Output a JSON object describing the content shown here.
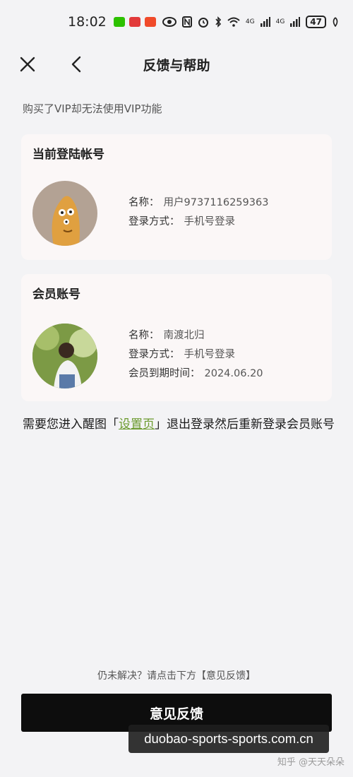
{
  "status_bar": {
    "time": "18:02",
    "network_4g_1": "4G",
    "network_4g_2": "4G",
    "battery": "47"
  },
  "nav": {
    "title": "反馈与帮助"
  },
  "section_title": "购买了VIP却无法使用VIP功能",
  "current_account": {
    "title": "当前登陆帐号",
    "name_label": "名称：",
    "name_value": "用户9737116259363",
    "login_label": "登录方式：",
    "login_value": "手机号登录"
  },
  "member_account": {
    "title": "会员账号",
    "name_label": "名称：",
    "name_value": "南渡北归",
    "login_label": "登录方式：",
    "login_value": "手机号登录",
    "expiry_label": "会员到期时间：",
    "expiry_value": "2024.06.20"
  },
  "note": {
    "before": "需要您进入醒图「",
    "link": "设置页",
    "after": "」退出登录然后重新登录会员账号"
  },
  "hint": "仍未解决？请点击下方【意见反馈】",
  "feedback_button": "意见反馈",
  "watermark": {
    "url": "duobao-sports-sports.com.cn",
    "credit": "知乎 @天天朵朵"
  }
}
